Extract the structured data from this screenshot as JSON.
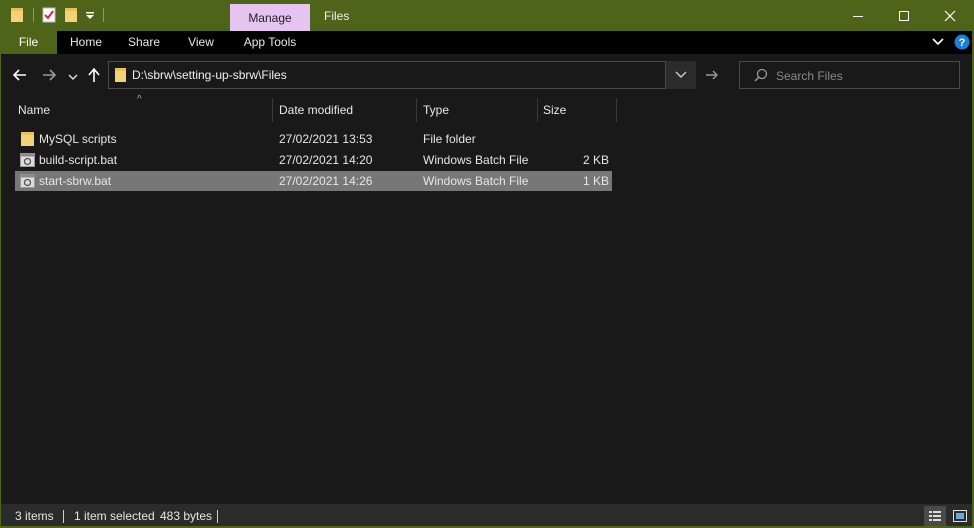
{
  "window": {
    "title": "Files",
    "contextual_tab": "Manage",
    "accent": "#4e6419",
    "contextual_color": "#e6c4f2"
  },
  "quick_access": {
    "icons": [
      "folder-icon",
      "properties-check-icon",
      "new-folder-icon",
      "customize-dropdown-icon"
    ]
  },
  "ribbon": {
    "tabs": [
      {
        "label": "File"
      },
      {
        "label": "Home"
      },
      {
        "label": "Share"
      },
      {
        "label": "View"
      },
      {
        "label": "App Tools"
      }
    ]
  },
  "nav": {
    "address": "D:\\sbrw\\setting-up-sbrw\\Files",
    "search_placeholder": "Search Files"
  },
  "columns": {
    "name": "Name",
    "date": "Date modified",
    "type": "Type",
    "size": "Size",
    "sort_indicator": "^"
  },
  "files": [
    {
      "name": "MySQL scripts",
      "date": "27/02/2021 13:53",
      "type": "File folder",
      "size": "",
      "icon": "folder-icon",
      "selected": false
    },
    {
      "name": "build-script.bat",
      "date": "27/02/2021 14:20",
      "type": "Windows Batch File",
      "size": "2 KB",
      "icon": "batch-file-icon",
      "selected": false
    },
    {
      "name": "start-sbrw.bat",
      "date": "27/02/2021 14:26",
      "type": "Windows Batch File",
      "size": "1 KB",
      "icon": "batch-file-icon",
      "selected": true
    }
  ],
  "status": {
    "items_count": "3 items",
    "selection": "1 item selected",
    "selection_size": "483 bytes"
  }
}
